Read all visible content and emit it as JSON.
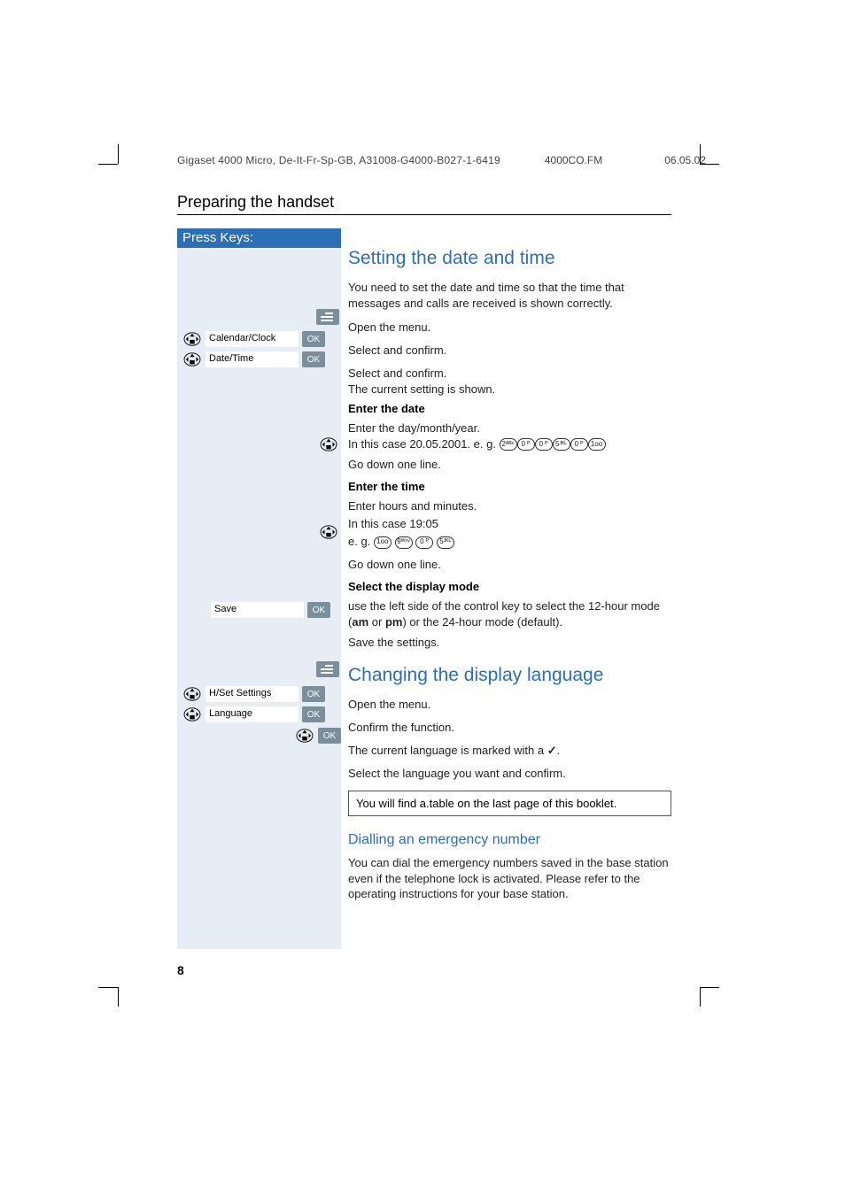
{
  "header": {
    "doc_id": "Gigaset 4000 Micro, De-It-Fr-Sp-GB, A31008-G4000-B027-1-6419",
    "file": "4000CO.FM",
    "date": "06.05.02"
  },
  "section_title": "Preparing the handset",
  "press_keys_label": "Press Keys:",
  "h2_datetime": "Setting the date and time",
  "p_intro": "You need to set the date and time so that the time that messages and calls are received is shown correctly.",
  "steps": {
    "open_menu": "Open the menu.",
    "select_confirm": "Select and confirm.",
    "select_confirm_current": "Select and confirm.\nThe current setting is shown.",
    "enter_date_label": "Enter the date",
    "enter_date_body": "Enter the day/month/year.\nIn this case 20.05.2001. e. g.",
    "go_down": "Go down one line.",
    "enter_time_label": "Enter the time",
    "enter_time_body1": "Enter hours and minutes.",
    "enter_time_body2": "In this case 19:05",
    "enter_time_body3": "e. g.  ",
    "select_mode_label": "Select the display mode",
    "select_mode_body": "use the left side of the control key to select the 12-hour mode (am or pm) or the 24-hour mode (default).",
    "save_settings": "Save the settings."
  },
  "left": {
    "calendar_clock": "Calendar/Clock",
    "date_time": "Date/Time",
    "save": "Save",
    "hset": "H/Set Settings",
    "language": "Language",
    "ok": "OK"
  },
  "date_keys": [
    "2ᴬᴮᶜ",
    "0 ᴾ",
    "0 ᴾ",
    "5ᴶᴷᴸ",
    "0 ᴾ",
    "1ᴏᴏ"
  ],
  "time_keys": [
    "1ᴏᴏ",
    "9ᵂˣʸ",
    "0 ᴾ",
    "5ᴶᴷᴸ"
  ],
  "h2_lang": "Changing the display language",
  "lang_steps": {
    "open_menu": "Open the menu.",
    "confirm_fn": "Confirm the function.",
    "current_lang": "The current language is marked with a ",
    "select_lang": "Select the language you want and confirm."
  },
  "note": "You will find a.table on the last page of this booklet.",
  "h3_emergency": "Dialling an emergency number",
  "p_emergency": "You can dial the emergency numbers saved in the base station even if the telephone lock is activated. Please refer to the operating instructions for your base station.",
  "page_number": "8"
}
